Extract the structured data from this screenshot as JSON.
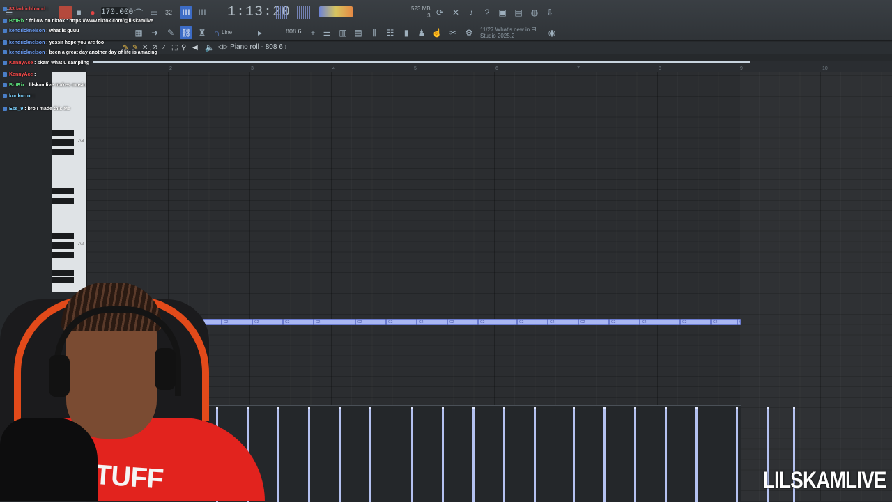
{
  "toolbar": {
    "tempo": "170.000",
    "time_sig": "32",
    "clock": "1:13:20",
    "memory": "523 MB",
    "memory_sub": "3",
    "snap_label": "Line",
    "snap_value": "808 6",
    "whats_new_date": "11/27",
    "whats_new_title": "What's new in FL",
    "whats_new_sub": "Studio 2025.2"
  },
  "piano_roll": {
    "title": "Piano roll - 808 6",
    "bar_numbers": [
      "2",
      "3",
      "4",
      "5",
      "6",
      "7",
      "8",
      "9",
      "10"
    ],
    "key_labels": [
      "A3",
      "A2"
    ],
    "note_label": "C2",
    "note_count": 19
  },
  "chat": [
    {
      "user": "83dadrichblood",
      "sep": ":",
      "msg": "",
      "color": "c-red"
    },
    {
      "user": "BotRix",
      "sep": ":",
      "msg": "follow on tiktok : https://www.tiktok.com/@lilskamlive",
      "color": "c-green"
    },
    {
      "user": "kendricknelson",
      "sep": ":",
      "msg": "what is guuu",
      "color": "c-blue"
    },
    {
      "user": "kendricknelson",
      "sep": ":",
      "msg": "yessir hope you are too",
      "color": "c-blue"
    },
    {
      "user": "kendricknelson",
      "sep": ":",
      "msg": "been a great day another day of life is amazing",
      "color": "c-blue"
    },
    {
      "user": "KennyAce",
      "sep": ":",
      "msg": "skam what u sampling",
      "color": "c-red"
    },
    {
      "user": "KennyAce",
      "sep": ":",
      "msg": "",
      "color": "c-red"
    },
    {
      "user": "BotRix",
      "sep": ":",
      "msg": "lilskamlive makes music",
      "color": "c-green"
    },
    {
      "user": "konkorror",
      "sep": ":",
      "msg": "",
      "color": "c-teal"
    },
    {
      "user": "Ess_9",
      "sep": ":",
      "msg": "bro I made this Me",
      "color": "c-teal"
    }
  ],
  "webcam": {
    "shirt_text": "S TUFF"
  },
  "watermark": "LILSKAMLIVE",
  "colors": {
    "note_fill": "#a9b7f3",
    "grid_bg": "#2b2d30",
    "accent_red": "#e2231e"
  }
}
